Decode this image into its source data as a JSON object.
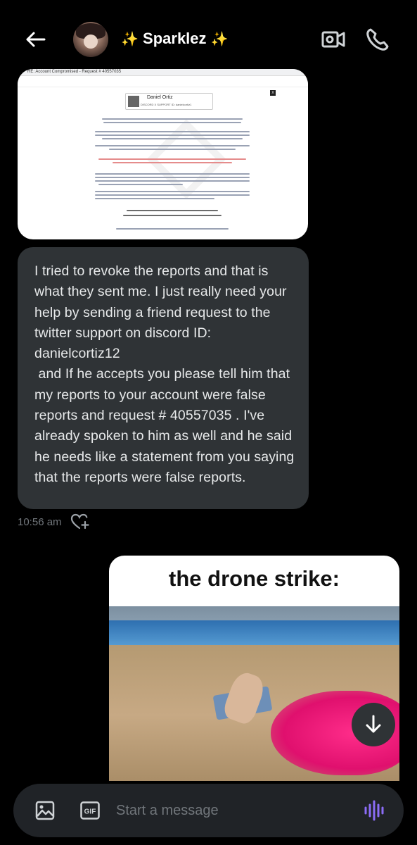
{
  "header": {
    "contact_name": "Sparklez",
    "sparkle_left": "✨",
    "sparkle_right": "✨"
  },
  "email_preview": {
    "subject": "RE: Account Compromised - Request # 40557035",
    "sender_name": "Daniel Ortiz",
    "sender_sub": "DISCORD X SUPPORT  ID: danielcortiz1",
    "close_label": "X"
  },
  "message": {
    "text": "I tried to revoke the reports and that is what they sent me. I just really need your help by sending a friend request to the twitter support on discord ID: danielcortiz12\n and If he accepts you please tell him that my reports to your account were false reports and request # 40557035 . I've already spoken to him as well and he said he needs like a statement from you saying that the reports were false reports.",
    "timestamp": "10:56 am"
  },
  "meme": {
    "caption": "the drone strike:"
  },
  "composer": {
    "placeholder": "Start a message"
  },
  "colors": {
    "background": "#000000",
    "bubble": "#2f3336",
    "accent_voice": "#8b6cf6"
  }
}
